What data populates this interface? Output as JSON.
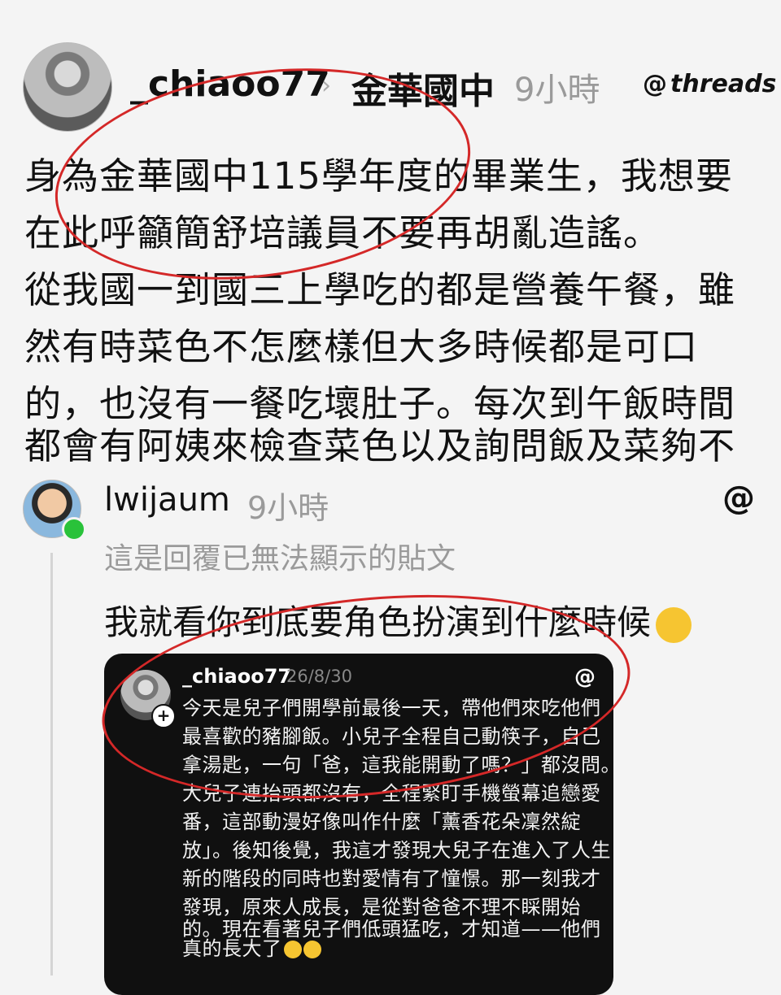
{
  "post": {
    "username": "_chiaoo77",
    "separator": "›",
    "community": "金華國中",
    "time": "9小時",
    "brand_mark": "@",
    "brand_word": "threads",
    "lines": [
      "身為金華國中115學年度的畢業生，我想要",
      "在此呼籲簡舒培議員不要再胡亂造謠。",
      "從我國一到國三上學吃的都是營養午餐，雖",
      "然有時菜色不怎麼樣但大多時候都是可口",
      "的，也沒有一餐吃壞肚子。每次到午飯時間",
      "都會有阿姨來檢查菜色以及詢問飯及菜夠不"
    ]
  },
  "reply": {
    "username": "lwijaum",
    "time": "9小時",
    "icon": "@",
    "note": "這是回覆已無法顯示的貼文",
    "text": "我就看你到底要角色扮演到什麼時候"
  },
  "quoted": {
    "username": "_chiaoo77",
    "date": "26/8/30",
    "icon": "@",
    "plus": "+",
    "lines": [
      "今天是兒子們開學前最後一天，帶他們來吃他們",
      "最喜歡的豬腳飯。小兒子全程自己動筷子，自己",
      "拿湯匙，一句「爸，這我能開動了嗎？」都沒問。",
      "大兒子連抬頭都沒有，全程緊盯手機螢幕追戀愛",
      "番，這部動漫好像叫作什麼「薰香花朵凜然綻",
      "放」。後知後覺，我這才發現大兒子在進入了人生",
      "新的階段的同時也對愛情有了憧憬。那一刻我才",
      "發現，原來人成長，是從對爸爸不理不睬開始",
      "的。現在看著兒子們低頭猛吃，才知道——他們",
      "真的長大了"
    ]
  },
  "colors": {
    "annotation_red": "#d42828",
    "online_green": "#29c23a",
    "card_bg": "#101010"
  }
}
